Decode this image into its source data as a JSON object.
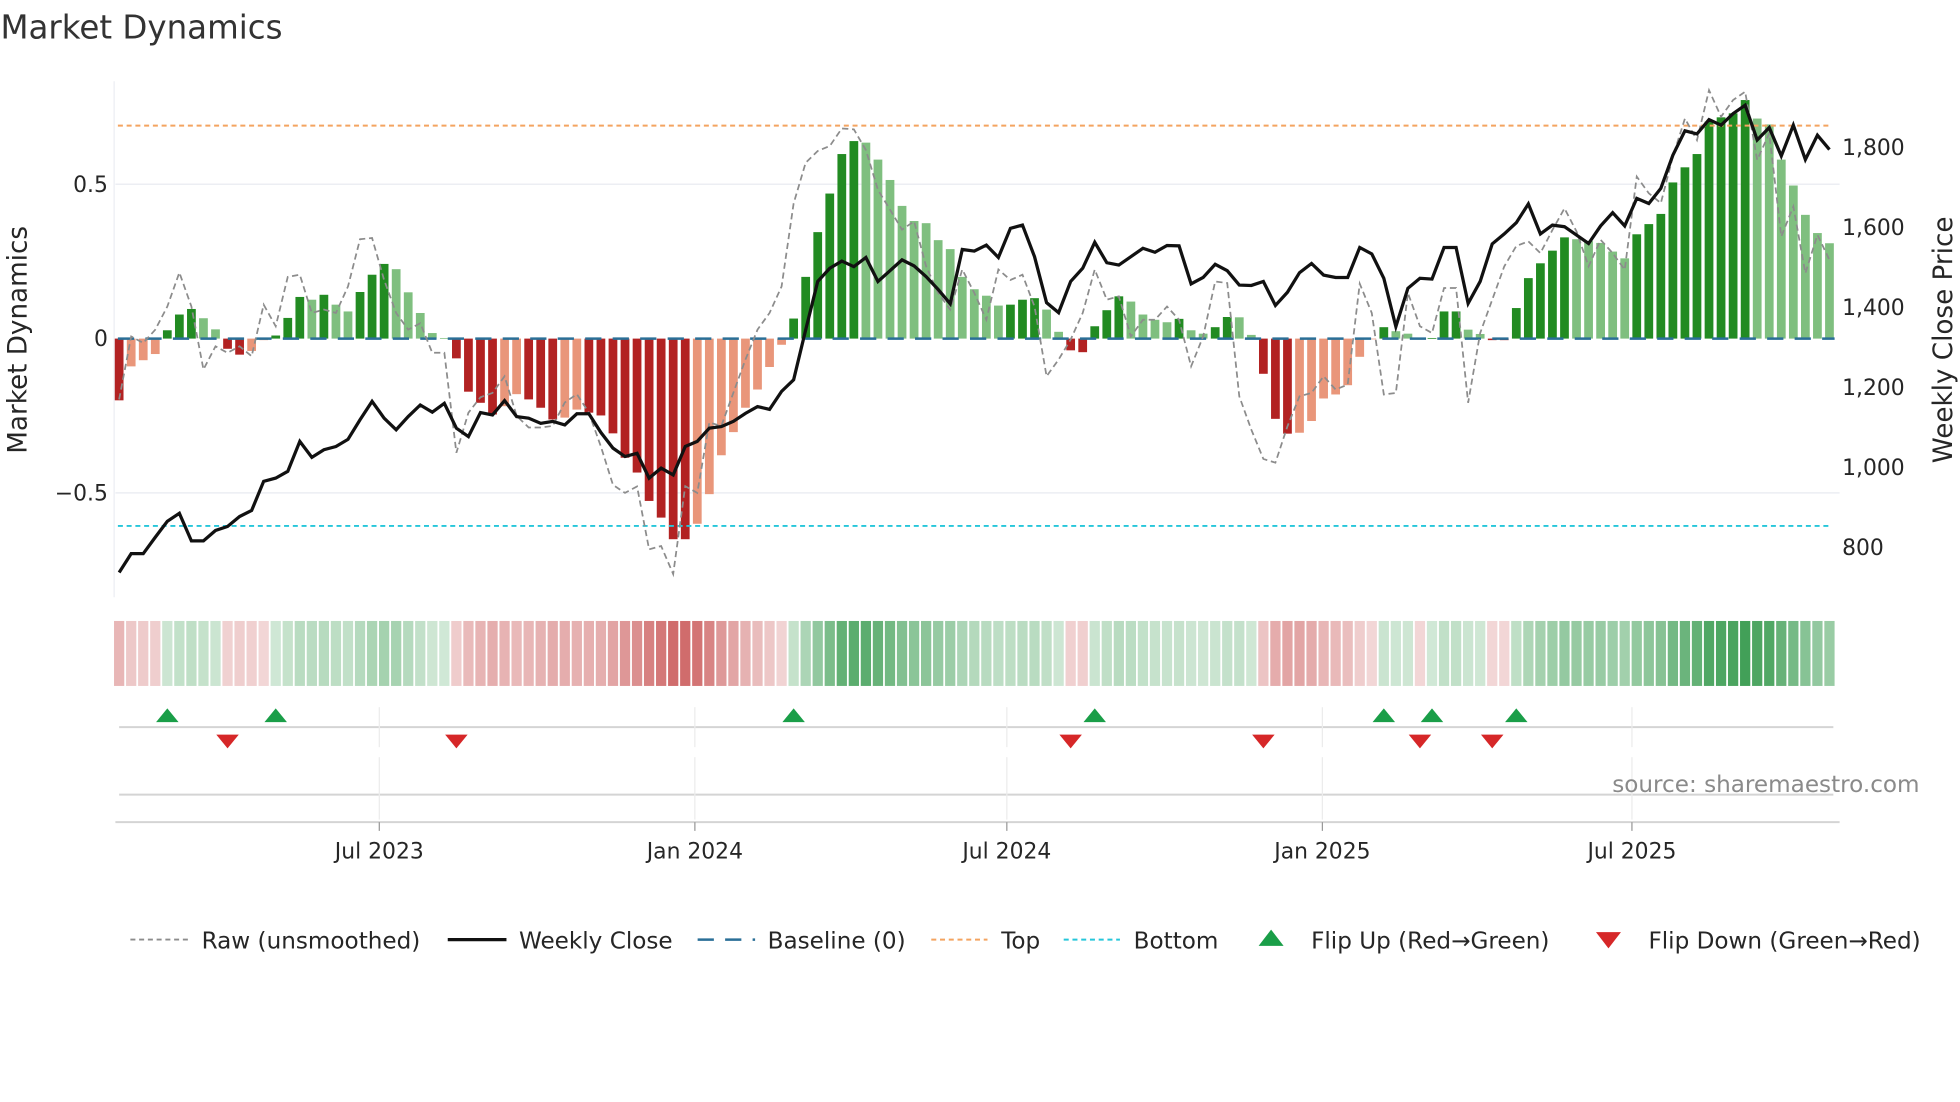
{
  "title": "Market Dynamics",
  "source": "source: sharemaestro.com",
  "colors": {
    "pos_strong": "#228b22",
    "pos_weak": "#7fbf7f",
    "neg_strong": "#b22222",
    "neg_weak": "#e9967a",
    "close": "#111111",
    "raw": "#8c8c8c",
    "baseline": "#2a6f97",
    "top": "#f4a460",
    "bottom": "#26c6da",
    "flip_up": "#1a9e48",
    "flip_down": "#d62728"
  },
  "chart_data": {
    "type": "bar",
    "title": "Market Dynamics",
    "ylabel": "Market Dynamics",
    "y2label": "Weekly Close Price",
    "ylim": [
      -0.838,
      0.834
    ],
    "y2lim": [
      675,
      1966
    ],
    "yticks": [
      {
        "value": 0.5,
        "label": "0.5"
      },
      {
        "value": 0,
        "label": "0"
      },
      {
        "value": -0.5,
        "label": "−0.5"
      }
    ],
    "y2ticks": [
      {
        "value": 1800,
        "label": "1,800"
      },
      {
        "value": 1600,
        "label": "1,600"
      },
      {
        "value": 1400,
        "label": "1,400"
      },
      {
        "value": 1200,
        "label": "1,200"
      },
      {
        "value": 1000,
        "label": "1,000"
      },
      {
        "value": 800,
        "label": "800"
      }
    ],
    "xticks": [
      {
        "week": 21.6,
        "label": "Jul 2023"
      },
      {
        "week": 47.8,
        "label": "Jan 2024"
      },
      {
        "week": 73.7,
        "label": "Jul 2024"
      },
      {
        "week": 99.9,
        "label": "Jan 2025"
      },
      {
        "week": 125.6,
        "label": "Jul 2025"
      }
    ],
    "thresholds": {
      "top": 0.69,
      "bottom": -0.607,
      "baseline": 0
    },
    "momentum": [
      -0.2,
      -0.09,
      -0.07,
      -0.05,
      0.027,
      0.078,
      0.096,
      0.066,
      0.03,
      -0.033,
      -0.052,
      -0.04,
      -0.005,
      0.01,
      0.067,
      0.135,
      0.126,
      0.142,
      0.11,
      0.088,
      0.151,
      0.207,
      0.242,
      0.225,
      0.15,
      0.083,
      0.018,
      0.002,
      -0.064,
      -0.172,
      -0.208,
      -0.246,
      -0.219,
      -0.18,
      -0.197,
      -0.224,
      -0.262,
      -0.256,
      -0.23,
      -0.24,
      -0.249,
      -0.307,
      -0.386,
      -0.434,
      -0.526,
      -0.58,
      -0.65,
      -0.65,
      -0.6,
      -0.504,
      -0.378,
      -0.303,
      -0.224,
      -0.165,
      -0.092,
      -0.02,
      0.065,
      0.2,
      0.345,
      0.47,
      0.598,
      0.64,
      0.635,
      0.58,
      0.514,
      0.43,
      0.381,
      0.374,
      0.319,
      0.29,
      0.2,
      0.16,
      0.139,
      0.107,
      0.11,
      0.126,
      0.131,
      0.094,
      0.022,
      -0.038,
      -0.044,
      0.04,
      0.092,
      0.137,
      0.12,
      0.078,
      0.061,
      0.053,
      0.064,
      0.027,
      0.016,
      0.037,
      0.07,
      0.069,
      0.012,
      -0.114,
      -0.26,
      -0.308,
      -0.305,
      -0.267,
      -0.194,
      -0.181,
      -0.151,
      -0.059,
      -0.002,
      0.037,
      0.024,
      0.016,
      -0.003,
      0.002,
      0.088,
      0.088,
      0.029,
      0.015,
      -0.005,
      -0.005,
      0.099,
      0.196,
      0.244,
      0.285,
      0.328,
      0.322,
      0.316,
      0.31,
      0.282,
      0.26,
      0.338,
      0.371,
      0.404,
      0.506,
      0.555,
      0.598,
      0.703,
      0.717,
      0.73,
      0.773,
      0.713,
      0.694,
      0.58,
      0.496,
      0.401,
      0.342,
      0.309
    ],
    "raw": [
      -0.197,
      0.007,
      -0.014,
      0.029,
      0.104,
      0.214,
      0.104,
      -0.1,
      -0.025,
      -0.046,
      -0.025,
      -0.057,
      0.11,
      0.04,
      0.2,
      0.207,
      0.083,
      0.094,
      0.083,
      0.169,
      0.322,
      0.326,
      0.19,
      0.083,
      0.029,
      0.05,
      -0.046,
      -0.046,
      -0.37,
      -0.24,
      -0.19,
      -0.176,
      -0.122,
      -0.25,
      -0.288,
      -0.288,
      -0.283,
      -0.207,
      -0.18,
      -0.24,
      -0.35,
      -0.474,
      -0.5,
      -0.479,
      -0.683,
      -0.672,
      -0.763,
      -0.478,
      -0.5,
      -0.272,
      -0.283,
      -0.175,
      -0.068,
      0.029,
      0.083,
      0.169,
      0.438,
      0.57,
      0.608,
      0.624,
      0.681,
      0.678,
      0.611,
      0.482,
      0.418,
      0.353,
      0.38,
      0.234,
      0.148,
      0.094,
      0.224,
      0.148,
      0.061,
      0.224,
      0.19,
      0.207,
      0.104,
      -0.122,
      -0.068,
      -0.003,
      0.083,
      0.224,
      0.126,
      0.137,
      0.007,
      0.061,
      0.061,
      0.104,
      0.061,
      -0.09,
      0.007,
      0.185,
      0.18,
      -0.187,
      -0.295,
      -0.39,
      -0.402,
      -0.284,
      -0.187,
      -0.176,
      -0.122,
      -0.165,
      -0.149,
      0.178,
      0.083,
      -0.181,
      -0.176,
      0.148,
      0.04,
      0.018,
      0.164,
      0.164,
      -0.208,
      0.018,
      0.126,
      0.234,
      0.3,
      0.315,
      0.277,
      0.352,
      0.422,
      0.347,
      0.234,
      0.32,
      0.277,
      0.223,
      0.525,
      0.471,
      0.439,
      0.59,
      0.713,
      0.643,
      0.805,
      0.719,
      0.773,
      0.8,
      0.579,
      0.665,
      0.331,
      0.428,
      0.212,
      0.336,
      0.255
    ],
    "close": [
      737,
      784,
      784,
      825,
      865,
      885,
      816,
      816,
      842,
      852,
      877,
      892,
      965,
      973,
      990,
      1065,
      1025,
      1044,
      1052,
      1070,
      1119,
      1165,
      1123,
      1094,
      1127,
      1156,
      1138,
      1160,
      1098,
      1077,
      1137,
      1131,
      1167,
      1127,
      1123,
      1110,
      1115,
      1106,
      1134,
      1134,
      1087,
      1048,
      1027,
      1035,
      973,
      998,
      981,
      1052,
      1065,
      1098,
      1102,
      1115,
      1135,
      1152,
      1145,
      1190,
      1219,
      1344,
      1465,
      1498,
      1516,
      1502,
      1525,
      1465,
      1492,
      1519,
      1504,
      1477,
      1445,
      1409,
      1545,
      1541,
      1556,
      1525,
      1598,
      1606,
      1527,
      1412,
      1387,
      1465,
      1498,
      1563,
      1512,
      1506,
      1527,
      1548,
      1538,
      1555,
      1554,
      1459,
      1475,
      1508,
      1492,
      1456,
      1455,
      1465,
      1405,
      1438,
      1487,
      1510,
      1481,
      1475,
      1475,
      1550,
      1534,
      1473,
      1352,
      1448,
      1473,
      1471,
      1550,
      1550,
      1410,
      1465,
      1559,
      1584,
      1612,
      1659,
      1584,
      1606,
      1602,
      1581,
      1560,
      1604,
      1637,
      1604,
      1673,
      1660,
      1698,
      1781,
      1842,
      1834,
      1870,
      1856,
      1885,
      1906,
      1819,
      1850,
      1779,
      1856,
      1770,
      1831,
      1795
    ],
    "legend": [
      {
        "key": "raw",
        "label": "Raw (unsmoothed)"
      },
      {
        "key": "close",
        "label": "Weekly Close"
      },
      {
        "key": "baseline",
        "label": "Baseline (0)"
      },
      {
        "key": "top",
        "label": "Top"
      },
      {
        "key": "bottom",
        "label": "Bottom"
      },
      {
        "key": "flip_up",
        "label": "Flip Up (Red→Green)"
      },
      {
        "key": "flip_down",
        "label": "Flip Down (Green→Red)"
      }
    ],
    "legend_position": "bottom"
  }
}
